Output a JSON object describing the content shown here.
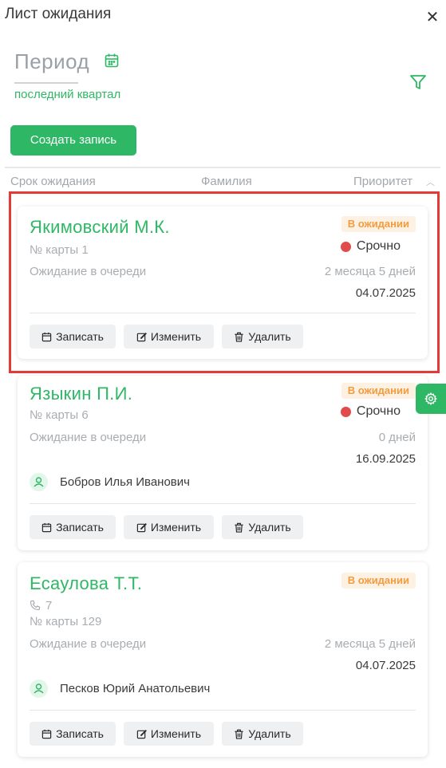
{
  "header": {
    "title": "Лист ожидания",
    "close_icon": "close-icon"
  },
  "period": {
    "label": "Период",
    "value": "последний квартал",
    "icon": "calendar-icon"
  },
  "filter": {
    "icon": "filter-icon"
  },
  "create_button": {
    "label": "Создать запись"
  },
  "columns": {
    "wait_time": "Срок ожидания",
    "surname": "Фамилия",
    "priority": "Приоритет",
    "sort_icon": "sort-up-icon"
  },
  "colors": {
    "accent": "#2eb865",
    "badge_bg": "#fdf1e4",
    "badge_text": "#f29c3d",
    "urgent": "#e04b4b",
    "highlight": "#e53935"
  },
  "cards": [
    {
      "name": "Якимовский М.К.",
      "status": "В ожидании",
      "priority": "Срочно",
      "card_number": "№ карты 1",
      "wait_label": "Ожидание в очереди",
      "wait_value": "2 месяца 5 дней",
      "date": "04.07.2025",
      "actions": {
        "book": "Записать",
        "edit": "Изменить",
        "delete": "Удалить"
      }
    },
    {
      "name": "Языкин П.И.",
      "status": "В ожидании",
      "priority": "Срочно",
      "card_number": "№ карты 6",
      "wait_label": "Ожидание в очереди",
      "wait_value": "0 дней",
      "date": "16.09.2025",
      "doctor": "Бобров Илья Иванович",
      "actions": {
        "book": "Записать",
        "edit": "Изменить",
        "delete": "Удалить"
      }
    },
    {
      "name": "Есаулова Т.Т.",
      "status": "В ожидании",
      "phone": "7",
      "card_number": "№ карты 129",
      "wait_label": "Ожидание в очереди",
      "wait_value": "2 месяца 5 дней",
      "date": "04.07.2025",
      "doctor": "Песков Юрий Анатольевич",
      "actions": {
        "book": "Записать",
        "edit": "Изменить",
        "delete": "Удалить"
      }
    }
  ],
  "settings": {
    "icon": "gear-icon"
  }
}
